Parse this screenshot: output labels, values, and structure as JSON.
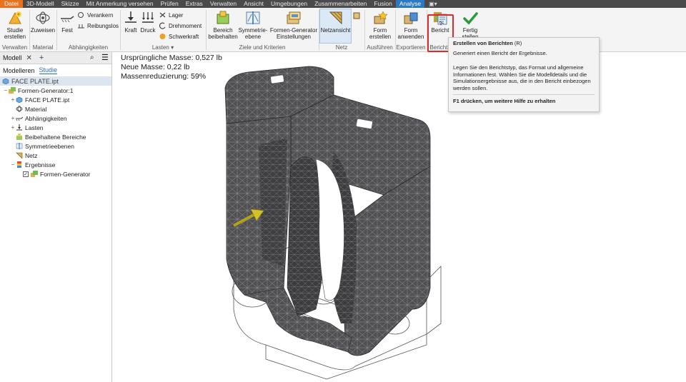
{
  "menubar": {
    "items": [
      "Datei",
      "3D-Modell",
      "Skizze",
      "Mit Anmerkung versehen",
      "Prüfen",
      "Extras",
      "Verwalten",
      "Ansicht",
      "Umgebungen",
      "Zusammenarbeiten",
      "Fusion",
      "Analyse"
    ],
    "active": "Analyse"
  },
  "ribbon": {
    "studie": "Studie\nerstellen",
    "zuweisen": "Zuweisen",
    "fest": "Fest",
    "verankern": "Verankern",
    "reibungslos": "Reibungslos",
    "kraft": "Kraft",
    "druck": "Druck",
    "lager": "Lager",
    "drehmoment": "Drehmoment",
    "schwerkraft": "Schwerkraft",
    "bereich": "Bereich\nbeibehalten",
    "symmetrie": "Symmetrie-\nebene",
    "formen_gen": "Formen-Generator\nEinstellungen",
    "netzansicht": "Netzansicht",
    "form_erstellen": "Form\nerstellen",
    "form_anwenden": "Form\nanwenden",
    "bericht": "Bericht",
    "fertig": "Fertig stellen",
    "groups": {
      "verwalten": "Verwalten",
      "material": "Material",
      "abhaengigkeiten": "Abhängigkeiten",
      "lasten": "Lasten ▾",
      "ziele": "Ziele und Kriterien",
      "netz": "Netz",
      "ausfuehren": "Ausführen",
      "exportieren": "Exportieren",
      "bericht": "Bericht"
    }
  },
  "panel": {
    "title": "Modell",
    "tabs": [
      "Modelleren",
      "Studie"
    ],
    "document": "FACE PLATE.ipt",
    "tree": [
      {
        "label": "Formen-Generator:1",
        "toggle": "−",
        "indent": 0,
        "icon": "generator"
      },
      {
        "label": "FACE PLATE.ipt",
        "toggle": "+",
        "indent": 1,
        "icon": "part"
      },
      {
        "label": "Material",
        "toggle": "",
        "indent": 1,
        "icon": "material"
      },
      {
        "label": "Abhängigkeiten",
        "toggle": "+",
        "indent": 1,
        "icon": "constraint"
      },
      {
        "label": "Lasten",
        "toggle": "+",
        "indent": 1,
        "icon": "load"
      },
      {
        "label": "Beibehaltene Bereiche",
        "toggle": "",
        "indent": 1,
        "icon": "keep"
      },
      {
        "label": "Symmetrieebenen",
        "toggle": "",
        "indent": 1,
        "icon": "symmetry"
      },
      {
        "label": "Netz",
        "toggle": "",
        "indent": 1,
        "icon": "mesh"
      },
      {
        "label": "Ergebnisse",
        "toggle": "−",
        "indent": 1,
        "icon": "results"
      },
      {
        "label": "Formen-Generator",
        "toggle": "",
        "indent": 2,
        "icon": "result-item"
      }
    ]
  },
  "viewport": {
    "mass_original": "Ursprüngliche Masse: 0,527 lb",
    "mass_new": "Neue Masse: 0,22 lb",
    "mass_reduction": "Massenreduzierung: 59%"
  },
  "tooltip": {
    "title": "Erstellen von Berichten",
    "shortcut": "(R)",
    "summary": "Generiert einen Bericht der Ergebnisse.",
    "details": "Legen Sie den Berichtstyp, das Format und allgemeine Informationen fest. Wählen Sie die Modelldetails und die Simulationsergebnisse aus, die in den Bericht einbezogen werden sollen.",
    "help": "F1 drücken, um weitere Hilfe zu erhalten"
  },
  "colors": {
    "accent": "#2b79c2",
    "file_tab": "#e8721d",
    "highlight": "#e02a2a",
    "mesh": "#4a4a4c"
  }
}
